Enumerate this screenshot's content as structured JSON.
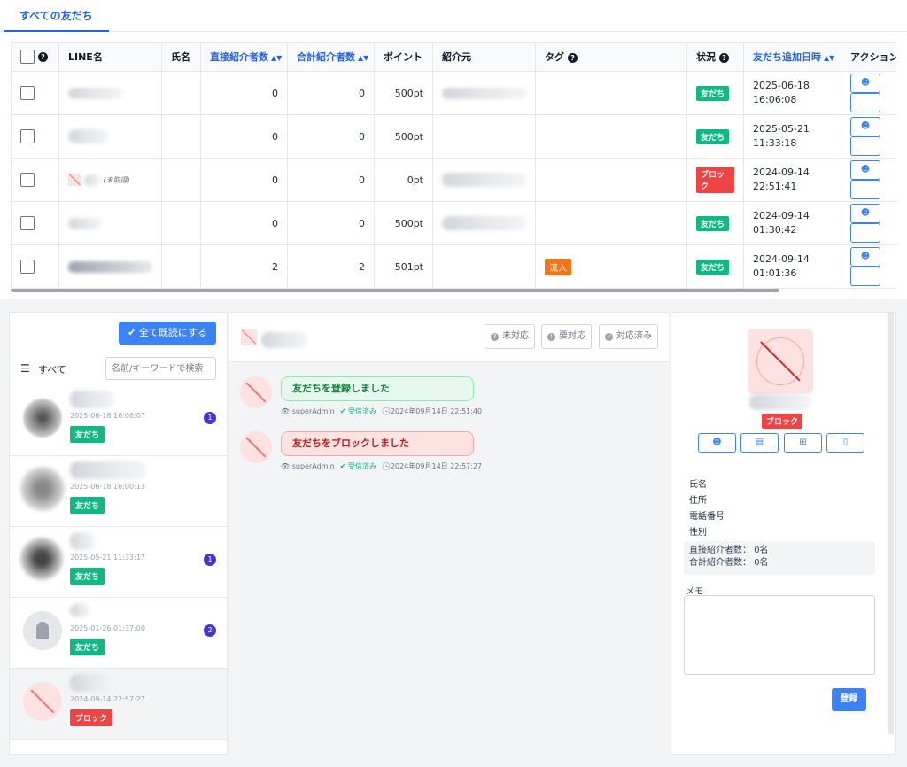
{
  "tabs": [
    {
      "label": "すべての友だち"
    }
  ],
  "table": {
    "headers": [
      "LINE名",
      "氏名",
      "直接紹介者数",
      "合計紹介者数",
      "ポイント",
      "紹介元",
      "タグ",
      "状況",
      "友だち追加日時",
      "アクション"
    ],
    "rows": [
      {
        "direct": "0",
        "total": "0",
        "points": "500pt",
        "status": "友だち",
        "date": "2025-06-18",
        "time": "16:06:08",
        "tag": ""
      },
      {
        "direct": "0",
        "total": "0",
        "points": "500pt",
        "status": "友だち",
        "date": "2025-05-21",
        "time": "11:33:18",
        "tag": ""
      },
      {
        "direct": "0",
        "total": "0",
        "points": "0pt",
        "status": "ブロック",
        "date": "2024-09-14",
        "time": "22:51:41",
        "tag": "",
        "unused": "(未取得)"
      },
      {
        "direct": "0",
        "total": "0",
        "points": "500pt",
        "status": "友だち",
        "date": "2024-09-14",
        "time": "01:30:42",
        "tag": ""
      },
      {
        "direct": "2",
        "total": "2",
        "points": "501pt",
        "status": "友だち",
        "date": "2024-09-14",
        "time": "01:01:36",
        "tag": "流入"
      }
    ]
  },
  "left": {
    "mark_all": "全て既読にする",
    "filter": "すべて",
    "search_placeholder": "名前/キーワードで検索",
    "conversations": [
      {
        "time": "2025-06-18 16:06:07",
        "tag": "友だち",
        "count": "1"
      },
      {
        "time": "2025-06-18 16:00:13",
        "tag": "友だち",
        "count": ""
      },
      {
        "time": "2025-05-21 11:33:17",
        "tag": "友だち",
        "count": "1"
      },
      {
        "time": "2025-01-26 01:37:00",
        "tag": "友だち",
        "count": "2"
      },
      {
        "time": "2024-09-14 22:57:27",
        "tag": "ブロック",
        "count": ""
      }
    ]
  },
  "chat": {
    "status_buttons": [
      "未対応",
      "要対応",
      "対応済み"
    ],
    "messages": [
      {
        "text": "友だちを登録しました",
        "user": "superAdmin",
        "state": "受信済み",
        "time": "2024年09月14日 22:51:40"
      },
      {
        "text": "友だちをブロックしました",
        "user": "superAdmin",
        "state": "受信済み",
        "time": "2024年09月14日 22:57:27"
      }
    ]
  },
  "profile": {
    "status": "ブロック",
    "fields": [
      "氏名",
      "住所",
      "電話番号",
      "性別"
    ],
    "direct_label": "直接紹介者数：",
    "direct_value": "0名",
    "total_label": "合計紹介者数：",
    "total_value": "0名",
    "memo_label": "メモ",
    "save": "登録"
  },
  "colors": {
    "accent": "#3b82f6",
    "friend": "#10b981",
    "blocked": "#ef4444",
    "tag": "#f97316"
  }
}
